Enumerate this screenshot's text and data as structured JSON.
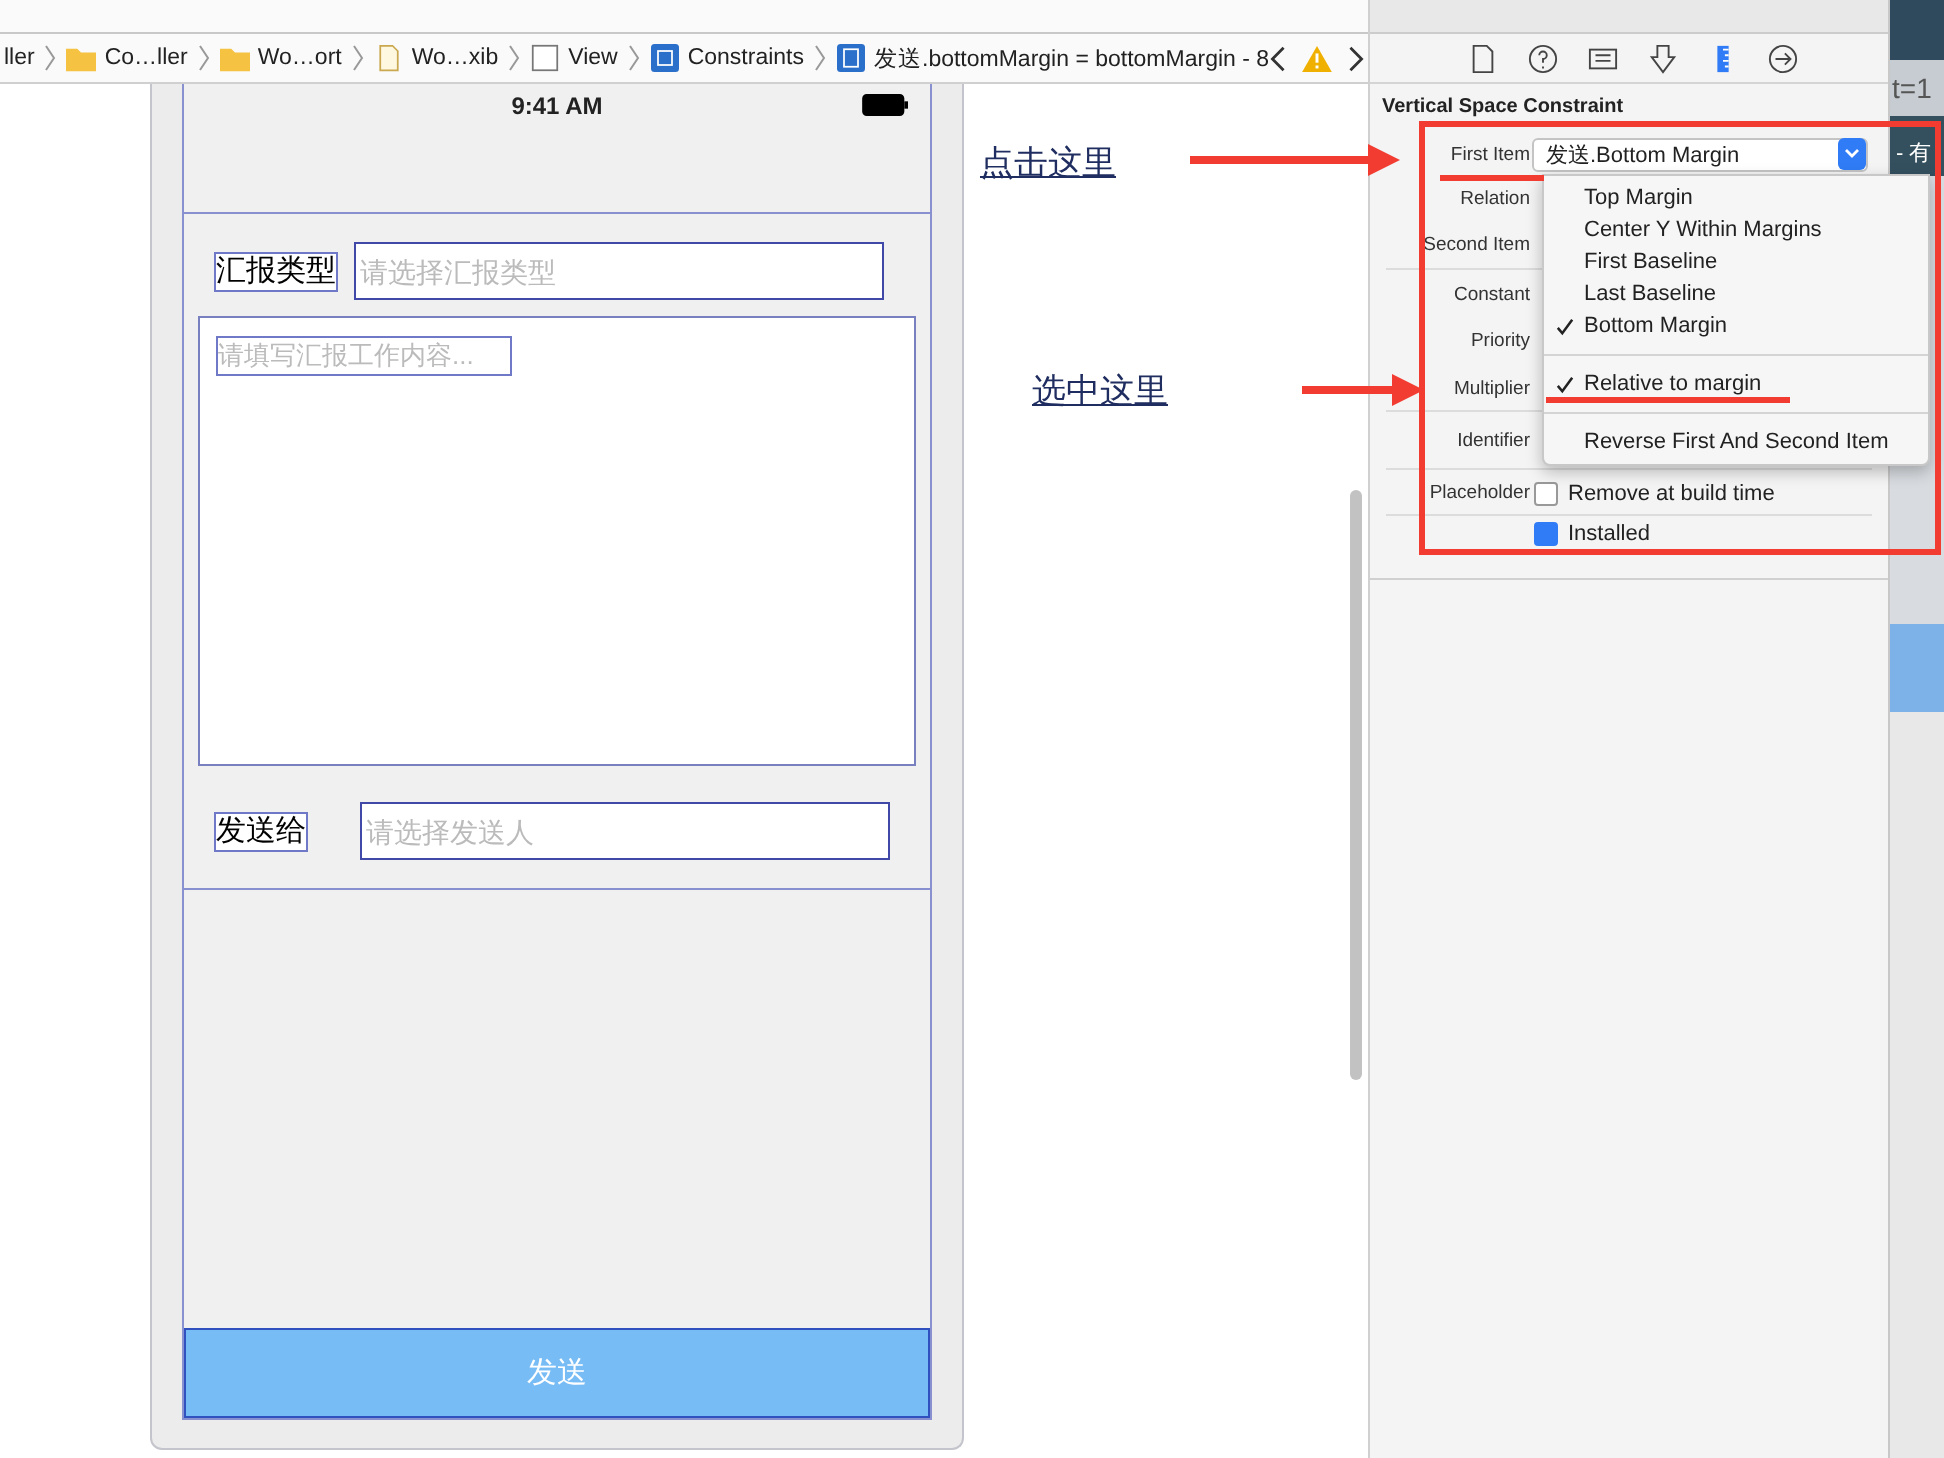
{
  "breadcrumbs": [
    {
      "kind": "none",
      "label": "ller"
    },
    {
      "kind": "folder",
      "label": "Co…ller"
    },
    {
      "kind": "folder",
      "label": "Wo…ort"
    },
    {
      "kind": "file",
      "label": "Wo…xib"
    },
    {
      "kind": "view",
      "label": "View"
    },
    {
      "kind": "constraints",
      "label": "Constraints"
    },
    {
      "kind": "constraint",
      "label": "发送.bottomMargin = bottomMargin - 8"
    }
  ],
  "phone": {
    "time": "9:41 AM",
    "type_label": "汇报类型",
    "type_field": {
      "placeholder": "请选择汇报类型"
    },
    "content_field": {
      "placeholder": "请填写汇报工作内容..."
    },
    "send_label": "发送给",
    "send_field": {
      "placeholder": "请选择发送人"
    },
    "send_button": "发送"
  },
  "annotations": [
    "点击这里",
    "选中这里"
  ],
  "inspector": {
    "tabs": [
      {
        "kind": "file",
        "selected": false
      },
      {
        "kind": "help",
        "selected": false
      },
      {
        "kind": "identity",
        "selected": false
      },
      {
        "kind": "attributes",
        "selected": false
      },
      {
        "kind": "size",
        "selected": true
      },
      {
        "kind": "connections",
        "selected": false
      }
    ],
    "title": "Vertical Space Constraint",
    "rows": [
      {
        "label": "First Item",
        "value": "发送.Bottom Margin"
      },
      {
        "label": "Relation"
      },
      {
        "label": "Second Item"
      },
      {
        "label": "Constant"
      },
      {
        "label": "Priority"
      },
      {
        "label": "Multiplier"
      },
      {
        "label": "Identifier"
      }
    ],
    "placeholder_row": {
      "label": "Placeholder",
      "option": "Remove at build time",
      "checked": false
    },
    "installed": {
      "label": "Installed",
      "checked": true
    },
    "menu": [
      {
        "kind": "item",
        "label": "Top Margin",
        "checked": false
      },
      {
        "kind": "item",
        "label": "Center Y Within Margins",
        "checked": false
      },
      {
        "kind": "item",
        "label": "First Baseline",
        "checked": false
      },
      {
        "kind": "item",
        "label": "Last Baseline",
        "checked": false
      },
      {
        "kind": "item",
        "label": "Bottom Margin",
        "checked": true
      },
      {
        "kind": "separator"
      },
      {
        "kind": "item",
        "label": "Relative to margin",
        "checked": true
      },
      {
        "kind": "separator"
      },
      {
        "kind": "item",
        "label": "Reverse First And Second Item",
        "checked": false
      }
    ]
  },
  "side_texts": [
    "t=1",
    "- 有"
  ]
}
